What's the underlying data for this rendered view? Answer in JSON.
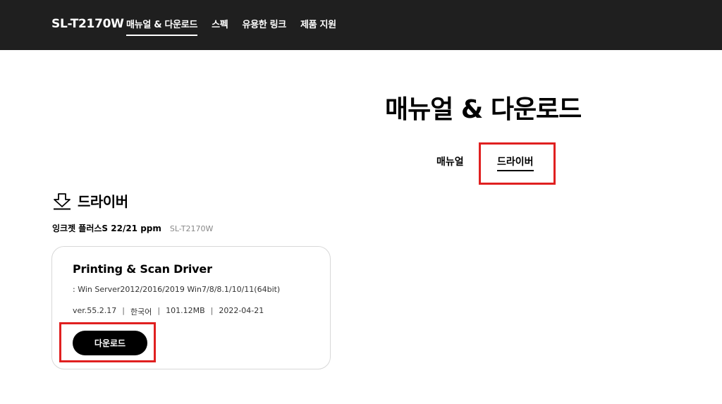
{
  "header": {
    "brand": "SL-T2170W",
    "nav": [
      "매뉴얼 & 다운로드",
      "스펙",
      "유용한 링크",
      "제품 지원"
    ]
  },
  "page": {
    "title": "매뉴얼 & 다운로드"
  },
  "tabs": {
    "manual": "매뉴얼",
    "driver": "드라이버"
  },
  "section": {
    "title": "드라이버",
    "product_name": "잉크젯 플러스S 22/21 ppm",
    "product_model": "SL-T2170W"
  },
  "card": {
    "title": "Printing & Scan Driver",
    "os": ": Win Server2012/2016/2019 Win7/8/8.1/10/11(64bit)",
    "version": "ver.55.2.17",
    "language": "한국어",
    "size": "101.12MB",
    "date": "2022-04-21",
    "separator": "|",
    "download_label": "다운로드"
  },
  "colors": {
    "nav_bg": "#1f1f1f",
    "highlight": "#e02020",
    "button_bg": "#000000"
  }
}
